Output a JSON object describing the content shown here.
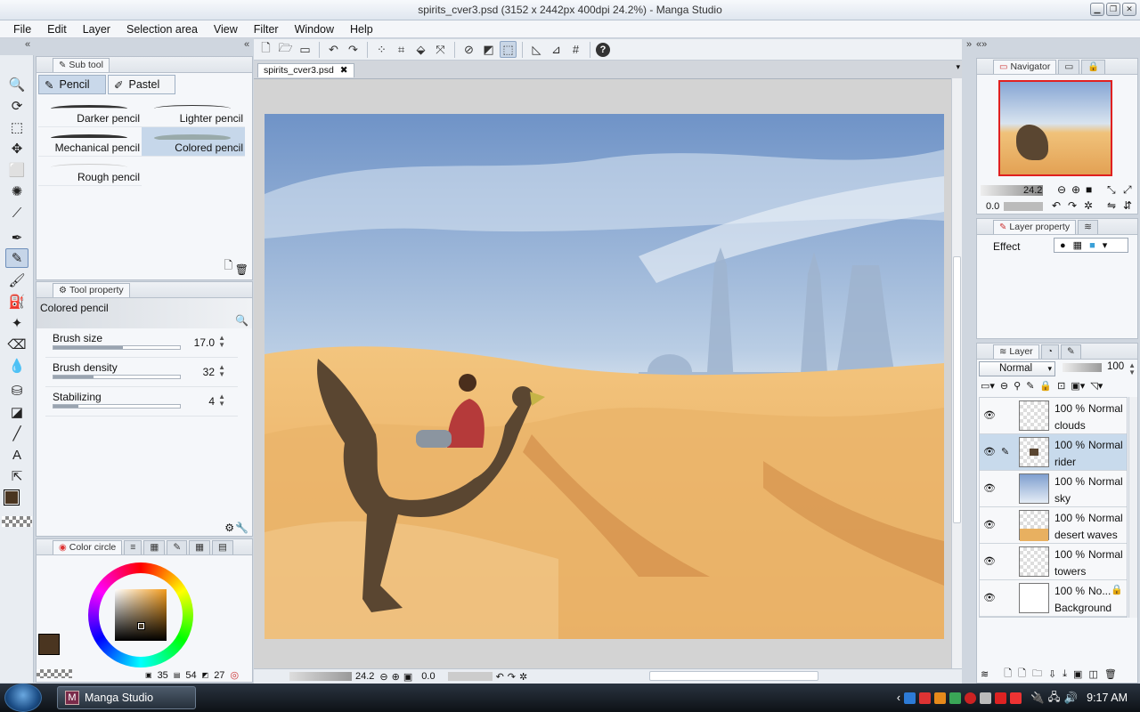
{
  "window": {
    "title": "spirits_cver3.psd (3152 x 2442px 400dpi 24.2%) - Manga Studio"
  },
  "menu": [
    "File",
    "Edit",
    "Layer",
    "Selection area",
    "View",
    "Filter",
    "Window",
    "Help"
  ],
  "subtool_panel": {
    "tab_label": "Sub tool",
    "group_tabs": [
      "Pencil",
      "Pastel"
    ],
    "brushes": [
      "Darker pencil",
      "Lighter pencil",
      "Mechanical pencil",
      "Colored pencil",
      "Rough pencil"
    ]
  },
  "tool_property": {
    "tab_label": "Tool property",
    "tool_name": "Colored pencil",
    "rows": [
      {
        "label": "Brush size",
        "value": "17.0",
        "fill": 0.55
      },
      {
        "label": "Brush density",
        "value": "32",
        "fill": 0.32
      },
      {
        "label": "Stabilizing",
        "value": "4",
        "fill": 0.2
      }
    ]
  },
  "color_panel": {
    "tab_label": "Color circle",
    "readout": {
      "v1": "35",
      "v2": "54",
      "v3": "27"
    },
    "main_color": "#4a3520",
    "sub_color": "#e3c9a3"
  },
  "document": {
    "tab_label": "spirits_cver3.psd",
    "zoom": "24.2",
    "angle": "0.0"
  },
  "navigator": {
    "tab_label": "Navigator",
    "zoom": "24.2",
    "angle": "0.0"
  },
  "layer_property": {
    "tab_label": "Layer property",
    "effect_label": "Effect"
  },
  "layer_panel": {
    "tab_label": "Layer",
    "blend_mode": "Normal",
    "opacity": "100",
    "layers": [
      {
        "opacity": "100 %",
        "mode": "Normal",
        "name": "clouds"
      },
      {
        "opacity": "100 %",
        "mode": "Normal",
        "name": "rider"
      },
      {
        "opacity": "100 %",
        "mode": "Normal",
        "name": "sky"
      },
      {
        "opacity": "100 %",
        "mode": "Normal",
        "name": "desert waves"
      },
      {
        "opacity": "100 %",
        "mode": "Normal",
        "name": "towers"
      },
      {
        "opacity": "100 %",
        "mode": "No...",
        "name": "Background"
      }
    ]
  },
  "taskbar": {
    "app_label": "Manga Studio",
    "app_letter": "M",
    "clock": "9:17 AM"
  },
  "colors": {
    "accent": "#c6d7ea",
    "chrome": "#e9edf2"
  }
}
